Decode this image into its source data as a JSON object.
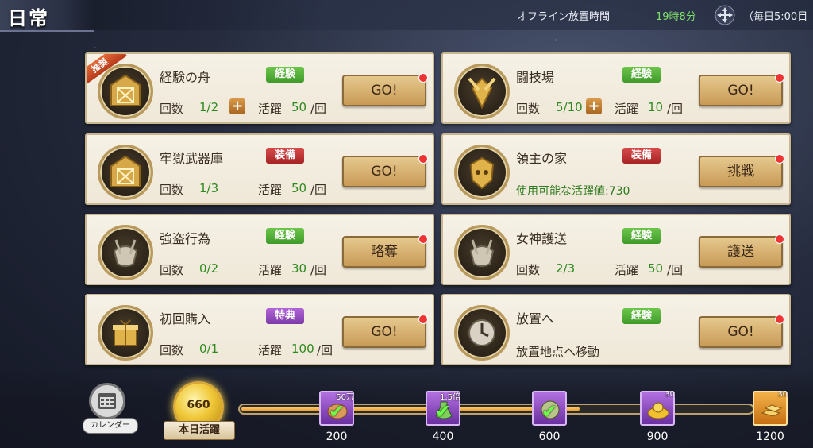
{
  "header": {
    "title": "日常",
    "offline_label": "オフライン放置時間",
    "offline_time": "19時8分",
    "daily_note": "（毎日5:00目"
  },
  "cards": [
    {
      "name": "経験の舟",
      "tag": "経験",
      "tag_color": "green",
      "ribbon": "推奨",
      "count_label": "回数",
      "count": "1/2",
      "act_label": "活躍",
      "act": "50",
      "act_unit": "/回",
      "button": "GO!"
    },
    {
      "name": "闘技場",
      "tag": "経験",
      "tag_color": "green",
      "count_label": "回数",
      "count": "5/10",
      "act_label": "活躍",
      "act": "10",
      "act_unit": "/回",
      "button": "GO!"
    },
    {
      "name": "牢獄武器庫",
      "tag": "装備",
      "tag_color": "red",
      "count_label": "回数",
      "count": "1/3",
      "act_label": "活躍",
      "act": "50",
      "act_unit": "/回",
      "button": "GO!"
    },
    {
      "name": "領主の家",
      "tag": "装備",
      "tag_color": "red",
      "sub": "使用可能な活躍値:730",
      "button": "挑戦"
    },
    {
      "name": "強盗行為",
      "tag": "経験",
      "tag_color": "green",
      "count_label": "回数",
      "count": "0/2",
      "act_label": "活躍",
      "act": "30",
      "act_unit": "/回",
      "button": "略奪"
    },
    {
      "name": "女神護送",
      "tag": "経験",
      "tag_color": "green",
      "count_label": "回数",
      "count": "2/3",
      "act_label": "活躍",
      "act": "50",
      "act_unit": "/回",
      "button": "護送"
    },
    {
      "name": "初回購入",
      "tag": "特典",
      "tag_color": "purple",
      "count_label": "回数",
      "count": "0/1",
      "act_label": "活躍",
      "act": "100",
      "act_unit": "/回",
      "button": "GO!"
    },
    {
      "name": "放置へ",
      "tag": "経験",
      "tag_color": "green",
      "sub": "放置地点へ移動",
      "button": "GO!"
    }
  ],
  "bottom": {
    "calendar_label": "カレンダー",
    "activity_value": "660",
    "activity_label": "本日活躍",
    "progress_fraction": 0.66,
    "milestones": [
      {
        "value": "200",
        "badge": "50万",
        "claimed": true,
        "icon": "coin-pouch-icon"
      },
      {
        "value": "400",
        "badge": "1.5倍",
        "claimed": true,
        "icon": "potion-icon"
      },
      {
        "value": "600",
        "badge": "",
        "claimed": true,
        "icon": "compass-icon"
      },
      {
        "value": "900",
        "badge": "30",
        "claimed": false,
        "icon": "gold-pile-icon"
      },
      {
        "value": "1200",
        "badge": "30",
        "claimed": false,
        "icon": "gold-bars-icon"
      }
    ]
  }
}
